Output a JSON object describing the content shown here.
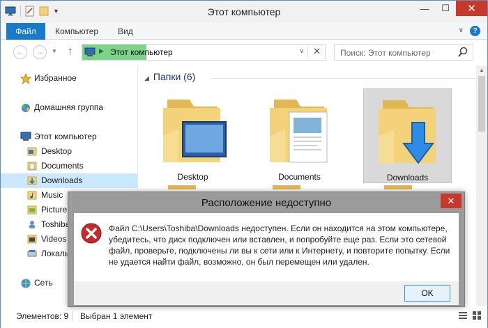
{
  "window": {
    "title": "Этот компьютер"
  },
  "ribbon": {
    "tabs": [
      "Файл",
      "Компьютер",
      "Вид"
    ]
  },
  "address": {
    "path": "Этот компьютер"
  },
  "search": {
    "placeholder": "Поиск: Этот компьютер"
  },
  "sidebar": {
    "items": [
      {
        "label": "Избранное",
        "icon": "star-icon"
      },
      {
        "label": "Домашняя группа",
        "icon": "homegroup-icon"
      },
      {
        "label": "Этот компьютер",
        "icon": "computer-icon"
      },
      {
        "label": "Desktop",
        "icon": "folder-icon"
      },
      {
        "label": "Documents",
        "icon": "folder-icon"
      },
      {
        "label": "Downloads",
        "icon": "folder-icon",
        "selected": true
      },
      {
        "label": "Music",
        "icon": "folder-icon"
      },
      {
        "label": "Picture",
        "icon": "folder-icon"
      },
      {
        "label": "Toshiba",
        "icon": "drive-icon"
      },
      {
        "label": "Videos",
        "icon": "folder-icon"
      },
      {
        "label": "Локаль",
        "icon": "drive-icon"
      },
      {
        "label": "Сеть",
        "icon": "network-icon"
      }
    ]
  },
  "content": {
    "group_title": "Папки (6)",
    "folders": [
      {
        "label": "Desktop",
        "icon": "desktop-folder-icon"
      },
      {
        "label": "Documents",
        "icon": "documents-folder-icon"
      },
      {
        "label": "Downloads",
        "icon": "downloads-folder-icon",
        "selected": true
      }
    ]
  },
  "status": {
    "items_count": "Элементов: 9",
    "selected": "Выбран 1 элемент"
  },
  "dialog": {
    "title": "Расположение недоступно",
    "message": "Файл C:\\Users\\Toshiba\\Downloads недоступен. Если он находится на этом компьютере, убедитесь, что диск подключен или вставлен, и попробуйте еще раз. Если это сетевой файл, проверьте, подключены ли вы к сети или к Интернету, и повторите попытку. Если не удается найти файл, возможно, он был перемещен или удален.",
    "ok_label": "OK",
    "close_glyph": "✕"
  },
  "colors": {
    "accent": "#1979ca",
    "close": "#c7392b",
    "selected_bg": "#cce8ff",
    "folder": "#f3d27a"
  }
}
